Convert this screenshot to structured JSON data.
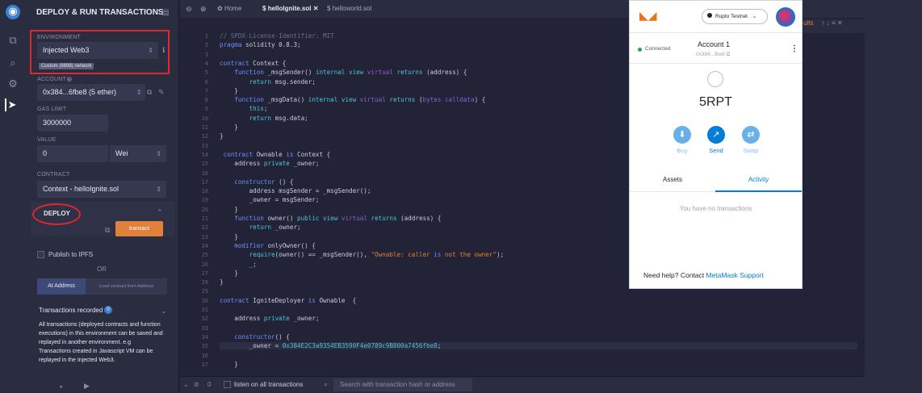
{
  "panel": {
    "title": "DEPLOY & RUN TRANSACTIONS",
    "environment_label": "ENVIRONMENT",
    "environment_value": "Injected Web3",
    "network_badge": "Custom (8898) network",
    "account_label": "ACCOUNT",
    "account_value": "0x384...6fbe8 (5 ether)",
    "gas_label": "GAS LIMIT",
    "gas_value": "3000000",
    "value_label": "VALUE",
    "value_amount": "0",
    "value_unit": "Wei",
    "contract_label": "CONTRACT",
    "contract_value": "Context - helloIgnite.sol",
    "deploy_label": "DEPLOY",
    "transact_label": "transact",
    "publish_label": "Publish to IPFS",
    "or_label": "OR",
    "at_address_label": "At Address",
    "load_contract_label": "Load contract from Address",
    "tx_recorded_label": "Transactions recorded",
    "tx_recorded_count": "0",
    "tx_description": "All transactions (deployed contracts and function executions) in this environment can be saved and replayed in another environment. e.g Transactions created in Javascript VM can be replayed in the Injected Web3."
  },
  "tabs": {
    "home": "Home",
    "tab1": "helloIgnite.sol",
    "tab2": "helloworld.sol"
  },
  "code": {
    "lines": [
      {
        "n": "1",
        "t": "// SPDX-License-Identifier: MIT"
      },
      {
        "n": "2",
        "t": "pragma solidity 0.8.3;"
      },
      {
        "n": "3",
        "t": ""
      },
      {
        "n": "4",
        "t": "contract Context {"
      },
      {
        "n": "5",
        "t": "    function _msgSender() internal view virtual returns (address) {"
      },
      {
        "n": "6",
        "t": "        return msg.sender;"
      },
      {
        "n": "7",
        "t": "    }"
      },
      {
        "n": "8",
        "t": "    function _msgData() internal view virtual returns (bytes calldata) {"
      },
      {
        "n": "9",
        "t": "        this;"
      },
      {
        "n": "10",
        "t": "        return msg.data;"
      },
      {
        "n": "11",
        "t": "    }"
      },
      {
        "n": "12",
        "t": "}"
      },
      {
        "n": "13",
        "t": ""
      },
      {
        "n": "14",
        "t": " contract Ownable is Context {"
      },
      {
        "n": "15",
        "t": "    address private _owner;"
      },
      {
        "n": "16",
        "t": ""
      },
      {
        "n": "17",
        "t": "    constructor () {"
      },
      {
        "n": "18",
        "t": "        address msgSender = _msgSender();"
      },
      {
        "n": "19",
        "t": "        _owner = msgSender;"
      },
      {
        "n": "20",
        "t": "    }"
      },
      {
        "n": "21",
        "t": "    function owner() public view virtual returns (address) {"
      },
      {
        "n": "22",
        "t": "        return _owner;"
      },
      {
        "n": "23",
        "t": "    }"
      },
      {
        "n": "24",
        "t": "    modifier onlyOwner() {"
      },
      {
        "n": "25",
        "t": "        require(owner() == _msgSender(), \"Ownable: caller is not the owner\");"
      },
      {
        "n": "26",
        "t": "        _;"
      },
      {
        "n": "27",
        "t": "    }"
      },
      {
        "n": "28",
        "t": "}"
      },
      {
        "n": "29",
        "t": ""
      },
      {
        "n": "30",
        "t": "contract IgniteDeployer is Ownable  {"
      },
      {
        "n": "31",
        "t": ""
      },
      {
        "n": "32",
        "t": "    address private _owner;"
      },
      {
        "n": "33",
        "t": ""
      },
      {
        "n": "34",
        "t": "    constructor() {"
      },
      {
        "n": "35",
        "t": "        _owner = 0x384E2C3a9354EB3590F4e0789c9B800a7456fbe8;"
      },
      {
        "n": "36",
        "t": ""
      },
      {
        "n": "37",
        "t": "    }"
      }
    ]
  },
  "bottom": {
    "count": "0",
    "listen_label": "listen on all transactions",
    "search_placeholder": "Search with transaction hash or address"
  },
  "metamask": {
    "network": "Rupto Testnet",
    "connected": "Connected",
    "account_name": "Account 1",
    "account_address": "0x384...fbe8",
    "balance": "5RPT",
    "buy": "Buy",
    "send": "Send",
    "swap": "Swap",
    "tab_assets": "Assets",
    "tab_activity": "Activity",
    "no_tx": "You have no transactions",
    "help_prefix": "Need help? Contact ",
    "help_link": "MetaMask Support"
  },
  "right_strip": {
    "partial_label": "ults"
  },
  "colors": {
    "accent_orange": "#e0813b",
    "redbox": "#e0262e",
    "metamask_blue": "#037dd6"
  }
}
